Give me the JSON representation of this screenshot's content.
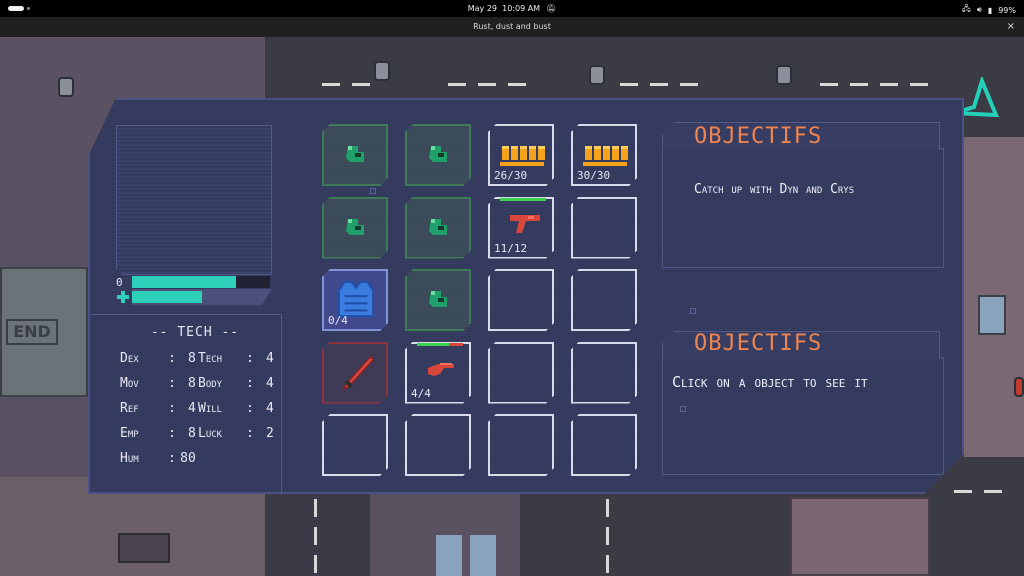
{
  "system_bar": {
    "date": "May 29",
    "time": "10:09 AM",
    "battery": "99%"
  },
  "window": {
    "title": "Rust, dust and bust",
    "close_glyph": "×"
  },
  "game": {
    "sign_text": "END"
  },
  "character": {
    "armor_value": "0",
    "armor_fill": 0.75,
    "health_fill": 0.5,
    "class_title": "-- TECH --",
    "stats": [
      {
        "label": "Dex",
        "value": "8"
      },
      {
        "label": "Tech",
        "value": "4"
      },
      {
        "label": "Mov",
        "value": "8"
      },
      {
        "label": "Body",
        "value": "4"
      },
      {
        "label": "Ref",
        "value": "4"
      },
      {
        "label": "Will",
        "value": "4"
      },
      {
        "label": "Emp",
        "value": "8"
      },
      {
        "label": "Luck",
        "value": "2"
      },
      {
        "label": "Hum",
        "value": "80"
      }
    ]
  },
  "inventory": {
    "slots": [
      {
        "type": "green",
        "icon": "glove-icon",
        "count": ""
      },
      {
        "type": "green",
        "icon": "glove-icon",
        "count": ""
      },
      {
        "type": "normal",
        "icon": "ammo-icon",
        "count": "26/30"
      },
      {
        "type": "normal",
        "icon": "ammo-icon",
        "count": "30/30"
      },
      {
        "type": "green",
        "icon": "glove-icon",
        "count": ""
      },
      {
        "type": "green",
        "icon": "glove-icon",
        "count": ""
      },
      {
        "type": "normal",
        "icon": "pistol-icon",
        "count": "11/12",
        "durability": 1.0
      },
      {
        "type": "empty",
        "icon": "",
        "count": ""
      },
      {
        "type": "blue",
        "icon": "vest-icon",
        "count": "0/4"
      },
      {
        "type": "green",
        "icon": "glove-icon",
        "count": ""
      },
      {
        "type": "empty",
        "icon": "",
        "count": ""
      },
      {
        "type": "empty",
        "icon": "",
        "count": ""
      },
      {
        "type": "red",
        "icon": "blade-icon",
        "count": ""
      },
      {
        "type": "normal",
        "icon": "shotgun-icon",
        "count": "4/4",
        "durability": 0.7
      },
      {
        "type": "empty",
        "icon": "",
        "count": ""
      },
      {
        "type": "empty",
        "icon": "",
        "count": ""
      },
      {
        "type": "empty",
        "icon": "",
        "count": ""
      },
      {
        "type": "empty",
        "icon": "",
        "count": ""
      },
      {
        "type": "empty",
        "icon": "",
        "count": ""
      },
      {
        "type": "empty",
        "icon": "",
        "count": ""
      }
    ]
  },
  "objectives": {
    "title": "OBJECTIFS",
    "text": "Catch up with Dyn and Crys"
  },
  "details": {
    "title": "OBJECTIFS",
    "text": "Click on a object to see it"
  },
  "colors": {
    "accent_teal": "#2dcfb9",
    "title_orange": "#f0844e",
    "panel": "#343a5e"
  }
}
